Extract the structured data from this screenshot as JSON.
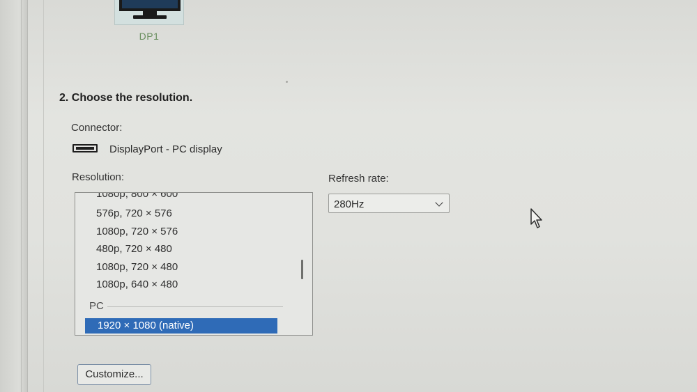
{
  "display": {
    "name": "DP1"
  },
  "step": {
    "title": "2. Choose the resolution."
  },
  "connector": {
    "label": "Connector:",
    "icon": "displayport-connector-icon",
    "value": "DisplayPort - PC display"
  },
  "resolution": {
    "label": "Resolution:",
    "items": [
      "1080p, 800 × 600",
      "576p, 720 × 576",
      "1080p, 720 × 576",
      "480p, 720 × 480",
      "1080p, 720 × 480",
      "1080p, 640 × 480"
    ],
    "group_label": "PC",
    "selected": "1920 × 1080 (native)"
  },
  "refresh_rate": {
    "label": "Refresh rate:",
    "selected": "280Hz"
  },
  "customize_button": {
    "label": "Customize..."
  },
  "colors": {
    "selection": "#2f6bb7",
    "display_label": "#6a8f5f"
  }
}
